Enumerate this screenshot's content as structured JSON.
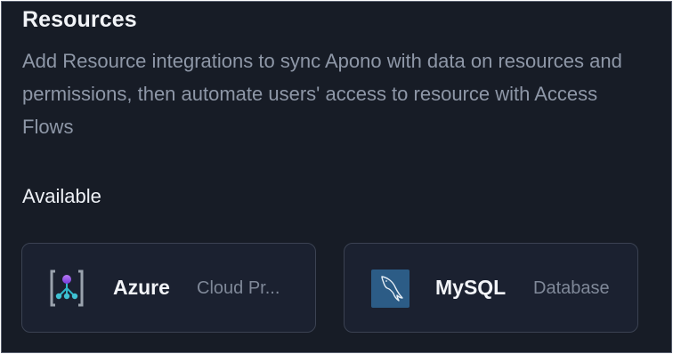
{
  "header": {
    "title": "Resources",
    "description": "Add Resource integrations to sync Apono with data on resources and permissions, then automate users' access to resource with Access Flows"
  },
  "available": {
    "label": "Available",
    "cards": [
      {
        "name": "Azure",
        "category": "Cloud Pr...",
        "icon": "azure-icon"
      },
      {
        "name": "MySQL",
        "category": "Database",
        "icon": "mysql-dolphin-icon"
      }
    ]
  },
  "colors": {
    "background": "#171c26",
    "card_background": "#1b2130",
    "card_border": "#3b4252",
    "text_primary": "#f2f4f8",
    "text_secondary": "#8e97a7",
    "mysql_logo_bg": "#2c5c86"
  }
}
